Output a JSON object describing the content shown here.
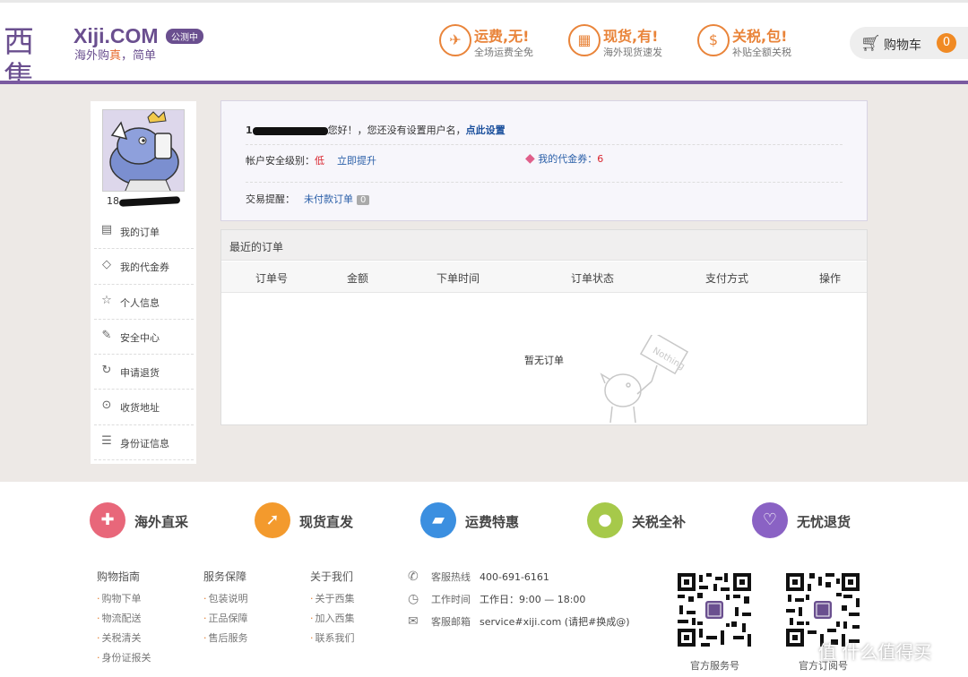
{
  "header": {
    "logo_cn": "西集",
    "logo_en": "Xiji.COM",
    "beta_badge": "公测中",
    "slogan_a": "海外购",
    "slogan_b": "真",
    "slogan_c": "，简单",
    "promos": [
      {
        "title": "运费,无!",
        "sub": "全场运费全免",
        "icon": "plane-icon"
      },
      {
        "title": "现货,有!",
        "sub": "海外现货速发",
        "icon": "gift-box-icon"
      },
      {
        "title": "关税,包!",
        "sub": "补贴全额关税",
        "icon": "dollar-icon"
      }
    ],
    "cart_label": "购物车",
    "cart_count": "0"
  },
  "sidebar": {
    "username_prefix": "18",
    "items": [
      {
        "label": "我的订单",
        "icon": "document-icon"
      },
      {
        "label": "我的代金券",
        "icon": "tag-icon"
      },
      {
        "label": "个人信息",
        "icon": "star-icon"
      },
      {
        "label": "安全中心",
        "icon": "edit-icon"
      },
      {
        "label": "申请退货",
        "icon": "refresh-icon"
      },
      {
        "label": "收货地址",
        "icon": "location-pin-icon"
      },
      {
        "label": "身份证信息",
        "icon": "id-card-icon"
      }
    ]
  },
  "info": {
    "user_prefix": "1",
    "greeting": "您好！，您还没有设置用户名，",
    "set_link": "点此设置",
    "security_label": "帐户安全级别：",
    "security_level": "低",
    "upgrade_link": "立即提升",
    "coupon_label": "我的代金券：",
    "coupon_count": "6",
    "reminder_label": "交易提醒：",
    "unpaid_label": "未付款订单",
    "unpaid_count": "0"
  },
  "orders": {
    "title": "最近的订单",
    "columns": [
      "订单号",
      "金额",
      "下单时间",
      "订单状态",
      "支付方式",
      "操作"
    ],
    "empty_text": "暂无订单",
    "illustration_text": "Nothing"
  },
  "features": [
    {
      "label": "海外直采",
      "color": "#e8677a"
    },
    {
      "label": "现货直发",
      "color": "#f39a2d"
    },
    {
      "label": "运费特惠",
      "color": "#3b8fe0"
    },
    {
      "label": "关税全补",
      "color": "#a6c94a"
    },
    {
      "label": "无忧退货",
      "color": "#8a62c4"
    }
  ],
  "footer": {
    "columns": [
      {
        "title": "购物指南",
        "items": [
          "购物下单",
          "物流配送",
          "关税清关",
          "身份证报关"
        ]
      },
      {
        "title": "服务保障",
        "items": [
          "包装说明",
          "正品保障",
          "售后服务"
        ]
      },
      {
        "title": "关于我们",
        "items": [
          "关于西集",
          "加入西集",
          "联系我们"
        ]
      }
    ],
    "contacts": [
      {
        "label": "客服热线",
        "value": "400-691-6161"
      },
      {
        "label": "工作时间",
        "value": "工作日：9:00 — 18:00"
      },
      {
        "label": "客服邮箱",
        "value": "service#xiji.com (请把#换成@)"
      }
    ],
    "qr_labels": [
      "官方服务号",
      "官方订阅号"
    ],
    "watermark": "值 什么值得买"
  }
}
